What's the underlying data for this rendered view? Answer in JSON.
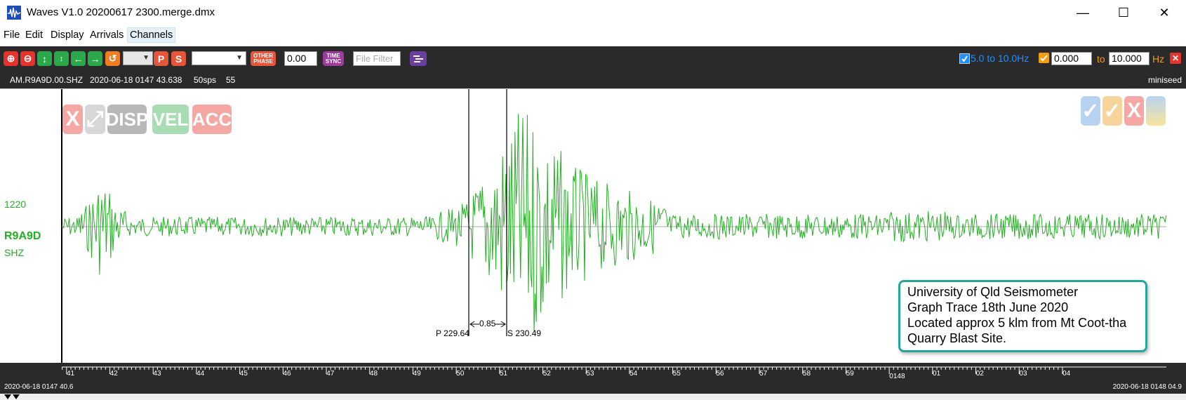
{
  "window": {
    "title": "Waves V1.0 20200617 2300.merge.dmx",
    "minimize": "—",
    "maximize": "☐",
    "close": "✕"
  },
  "menu": [
    "File",
    "Edit",
    "Display",
    "Arrivals",
    "Channels"
  ],
  "toolbar": {
    "zoom_in": "⊕",
    "zoom_out": "⊖",
    "scale_up": "↕",
    "scale_down": "↕",
    "pan_left": "←",
    "pan_right": "→",
    "undo": "↺",
    "pick_p": "P",
    "pick_s": "S",
    "other_phase_line1": "OTHER",
    "other_phase_line2": "PHASE",
    "offset_value": "0.00",
    "time_sync_line1": "TIME",
    "time_sync_line2": "SYNC",
    "file_filter_placeholder": "File Filter",
    "filter_label": "5.0 to 10.0Hz",
    "filter_low": "0.000",
    "to_label": "to",
    "filter_high": "10.000",
    "hz_label": "Hz",
    "close_x": "✕"
  },
  "info": {
    "channel": "AM.R9A9D.00.SHZ",
    "start_time": "2020-06-18 0147 43.638",
    "rate": "50sps",
    "count": "55",
    "format": "miniseed"
  },
  "trace": {
    "amplitude": "1220",
    "station": "R9A9D",
    "component": "SHZ",
    "color": "#22b022",
    "p_label": "P 229.64",
    "s_label": "S 230.49",
    "delta_label": "0.85"
  },
  "overlay": {
    "left_buttons": [
      "X",
      "⤢",
      "DISP",
      "VEL",
      "ACC"
    ],
    "right_buttons": [
      "✓",
      "✓",
      "X"
    ]
  },
  "timeline": {
    "ticks": [
      "41",
      "42",
      "43",
      "44",
      "45",
      "46",
      "47",
      "48",
      "49",
      "50",
      "51",
      "52",
      "53",
      "54",
      "55",
      "56",
      "57",
      "58",
      "59",
      "0148",
      "01",
      "02",
      "03",
      "04"
    ],
    "start_label": "2020-06-18 0147 40.6",
    "end_label": "2020-06-18 0148 04.9"
  },
  "annotation": {
    "line1": "University of Qld Seismometer",
    "line2": "Graph Trace 18th June 2020",
    "line3": "Located approx 5 klm from Mt Coot-tha",
    "line4": "Quarry Blast Site."
  }
}
